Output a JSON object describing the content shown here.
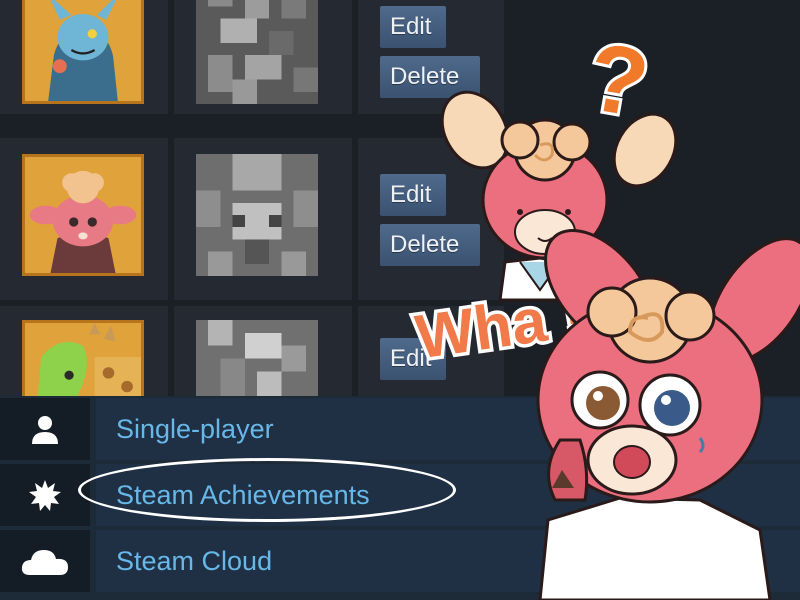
{
  "rows": [
    {
      "edit_label": "Edit",
      "delete_label": "Delete"
    },
    {
      "edit_label": "Edit",
      "delete_label": "Delete"
    },
    {
      "edit_label": "Edit"
    }
  ],
  "features": [
    {
      "label": "Single-player",
      "icon": "person-icon"
    },
    {
      "label": "Steam Achievements",
      "icon": "starburst-icon"
    },
    {
      "label": "Steam Cloud",
      "icon": "cloud-icon"
    }
  ],
  "sticker": {
    "exclaim_text": "Wha !?",
    "question_mark": "?"
  },
  "colors": {
    "button": "#4a6485",
    "feature_text": "#67b8e8",
    "avatar_frame": "#d4942a",
    "oval": "#ffffff",
    "sticker_text": "#f07a4a"
  }
}
